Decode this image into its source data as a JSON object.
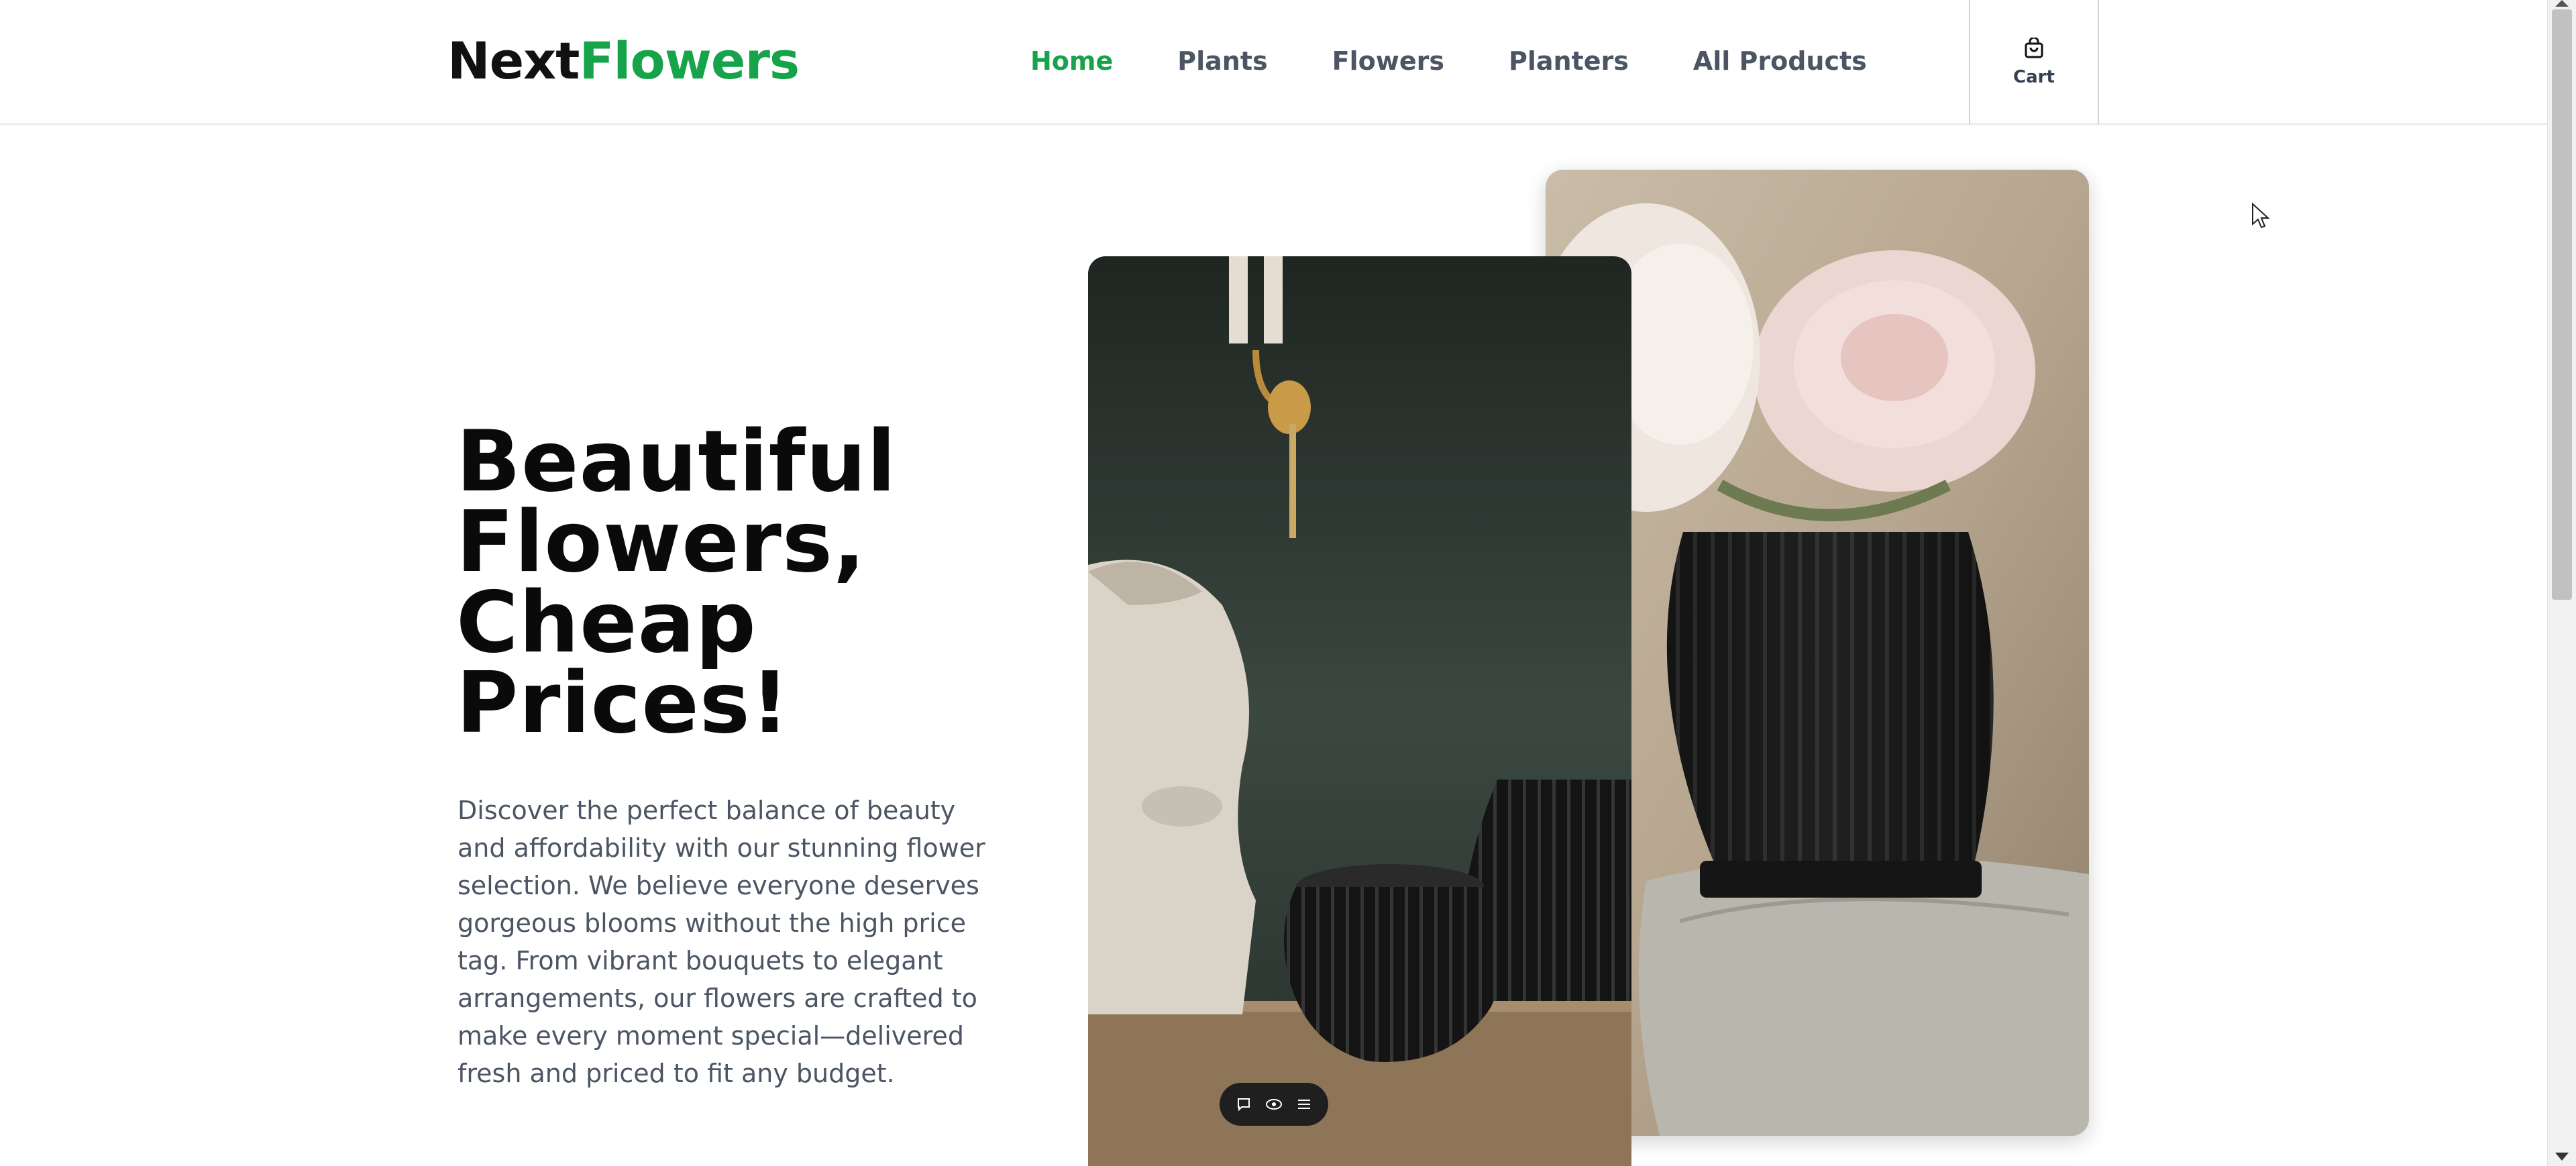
{
  "brand": {
    "part1": "Next",
    "part2": "Flowers"
  },
  "nav": {
    "items": [
      {
        "label": "Home",
        "active": true
      },
      {
        "label": "Plants",
        "active": false
      },
      {
        "label": "Flowers",
        "active": false
      },
      {
        "label": "Planters",
        "active": false
      },
      {
        "label": "All Products",
        "active": false
      }
    ]
  },
  "cart": {
    "label": "Cart",
    "icon": "shopping-bag-icon"
  },
  "hero": {
    "title": "Beautiful Flowers, Cheap Prices!",
    "description": "Discover the perfect balance of beauty and affordability with our stunning flower selection. We believe everyone deserves gorgeous blooms without the high price tag. From vibrant bouquets to elegant arrangements, our flowers are crafted to make every moment special—delivered fresh and priced to fit any budget.",
    "images": [
      {
        "name": "sculpture-bust-with-black-planters-photo"
      },
      {
        "name": "pink-roses-in-black-ribbed-vase-photo"
      }
    ]
  },
  "toolbar": {
    "icons": [
      "comment-icon",
      "eye-icon",
      "list-icon"
    ]
  },
  "colors": {
    "accent": "#16a34a",
    "text": "#111111",
    "muted": "#4b5563"
  }
}
